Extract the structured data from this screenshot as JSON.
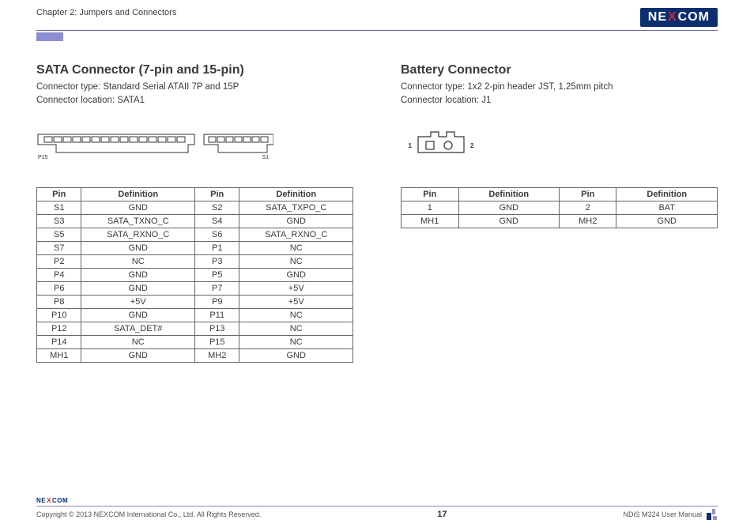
{
  "header": {
    "chapter": "Chapter 2: Jumpers and Connectors",
    "brand_left": "NE",
    "brand_x": "X",
    "brand_right": "COM"
  },
  "left": {
    "title": "SATA Connector (7-pin and 15-pin)",
    "type_line": "Connector type: Standard Serial ATAII 7P and 15P",
    "loc_line": "Connector location: SATA1",
    "diagram_labels": {
      "p15": "P15",
      "s1": "S1"
    },
    "table": {
      "headers": [
        "Pin",
        "Definition",
        "Pin",
        "Definition"
      ],
      "rows": [
        [
          "S1",
          "GND",
          "S2",
          "SATA_TXPO_C"
        ],
        [
          "S3",
          "SATA_TXNO_C",
          "S4",
          "GND"
        ],
        [
          "S5",
          "SATA_RXNO_C",
          "S6",
          "SATA_RXNO_C"
        ],
        [
          "S7",
          "GND",
          "P1",
          "NC"
        ],
        [
          "P2",
          "NC",
          "P3",
          "NC"
        ],
        [
          "P4",
          "GND",
          "P5",
          "GND"
        ],
        [
          "P6",
          "GND",
          "P7",
          "+5V"
        ],
        [
          "P8",
          "+5V",
          "P9",
          "+5V"
        ],
        [
          "P10",
          "GND",
          "P11",
          "NC"
        ],
        [
          "P12",
          "SATA_DET#",
          "P13",
          "NC"
        ],
        [
          "P14",
          "NC",
          "P15",
          "NC"
        ],
        [
          "MH1",
          "GND",
          "MH2",
          "GND"
        ]
      ]
    }
  },
  "right": {
    "title": "Battery Connector",
    "type_line": "Connector type: 1x2 2-pin header JST, 1.25mm pitch",
    "loc_line": "Connector location: J1",
    "diagram_labels": {
      "one": "1",
      "two": "2"
    },
    "table": {
      "headers": [
        "Pin",
        "Definition",
        "Pin",
        "Definition"
      ],
      "rows": [
        [
          "1",
          "GND",
          "2",
          "BAT"
        ],
        [
          "MH1",
          "GND",
          "MH2",
          "GND"
        ]
      ]
    }
  },
  "footer": {
    "copyright": "Copyright © 2013 NEXCOM International Co., Ltd. All Rights Reserved.",
    "page": "17",
    "manual": "NDiS M324 User Manual"
  }
}
